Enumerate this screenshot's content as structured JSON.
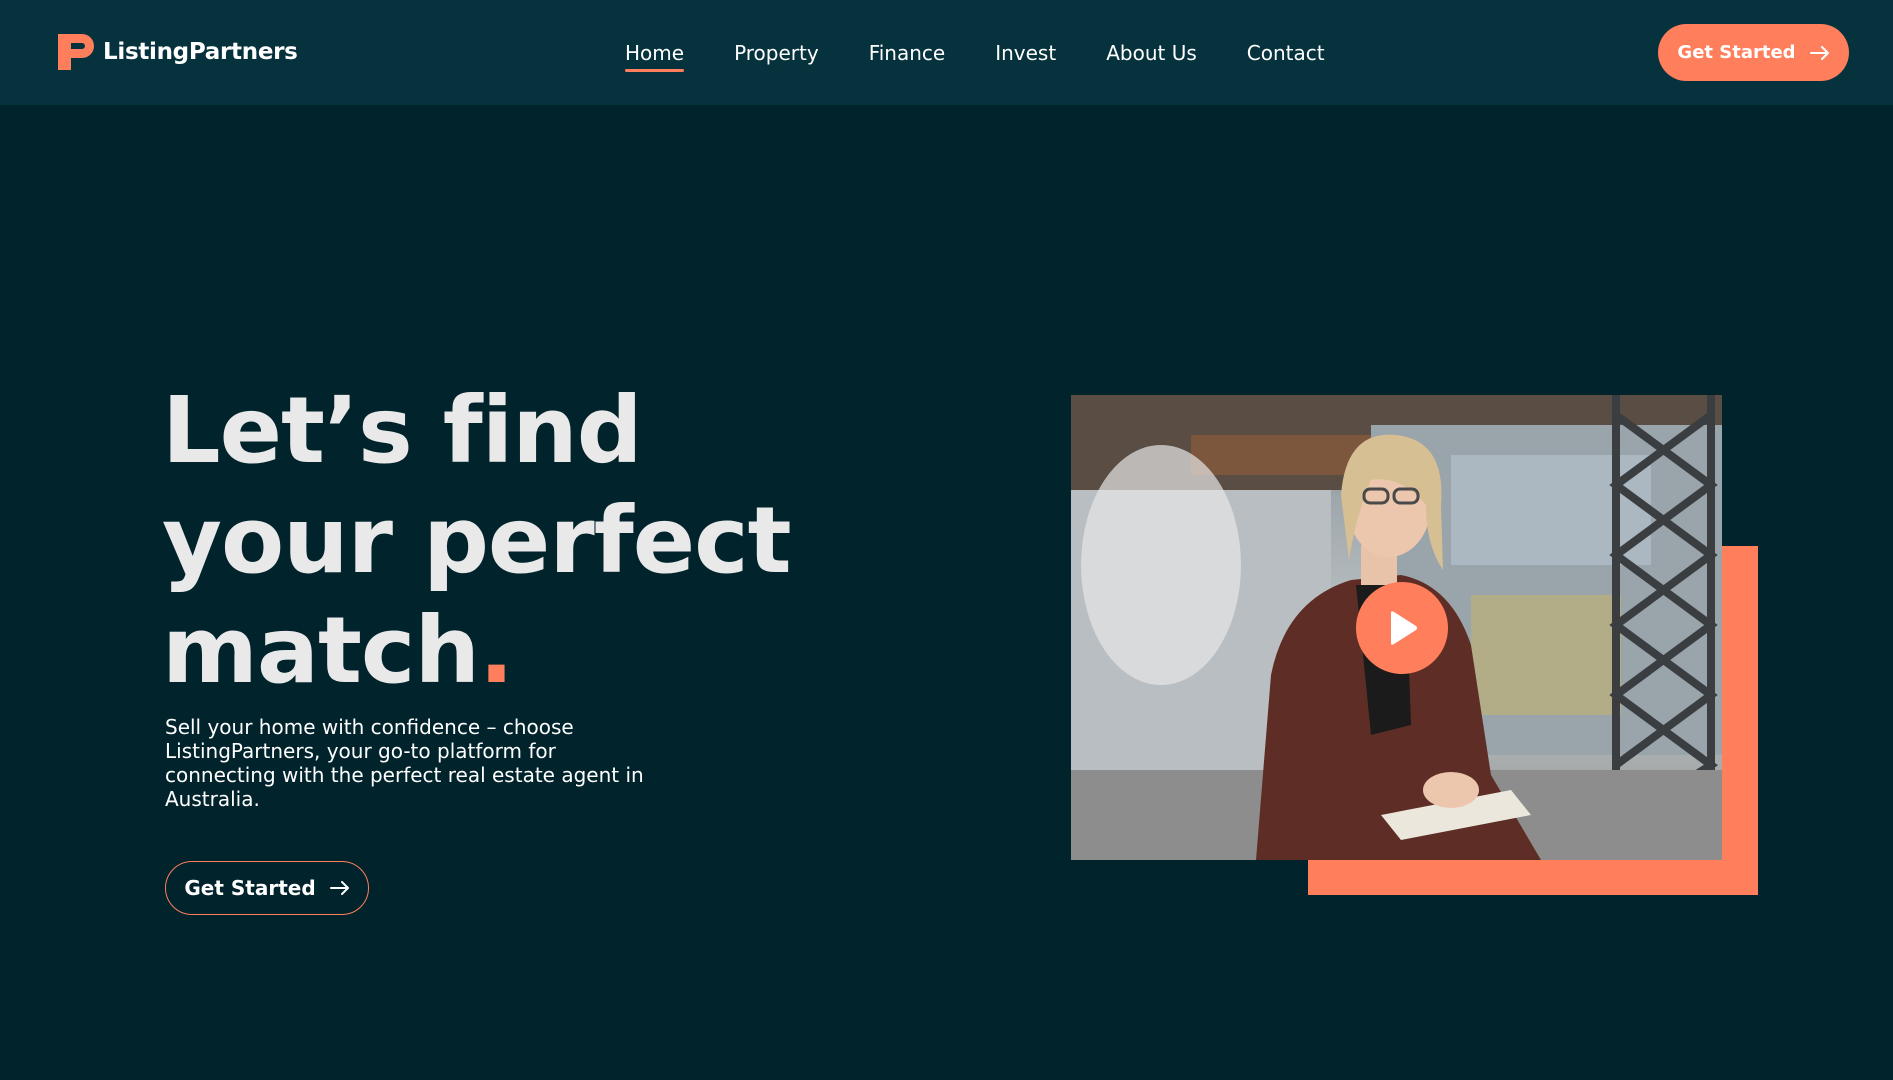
{
  "brand": {
    "name": "ListingPartners",
    "accent_color": "#ff7f5c",
    "background_color": "#01232c",
    "navbar_color": "#06323d"
  },
  "nav": {
    "items": [
      {
        "label": "Home",
        "active": true
      },
      {
        "label": "Property"
      },
      {
        "label": "Finance"
      },
      {
        "label": "Invest"
      },
      {
        "label": "About Us"
      },
      {
        "label": "Contact"
      }
    ],
    "cta": {
      "label": "Get Started",
      "icon": "arrow-right-icon"
    }
  },
  "hero": {
    "title_line1": "Let’s find",
    "title_line2": "your perfect",
    "title_line3": "match",
    "title_dot": ".",
    "description": "Sell your home with confidence – choose ListingPartners, your go-to platform for connecting with the perfect real estate agent in Australia.",
    "cta": {
      "label": "Get Started",
      "icon": "arrow-right-icon"
    }
  },
  "media": {
    "video": {
      "icon": "play-icon"
    }
  }
}
